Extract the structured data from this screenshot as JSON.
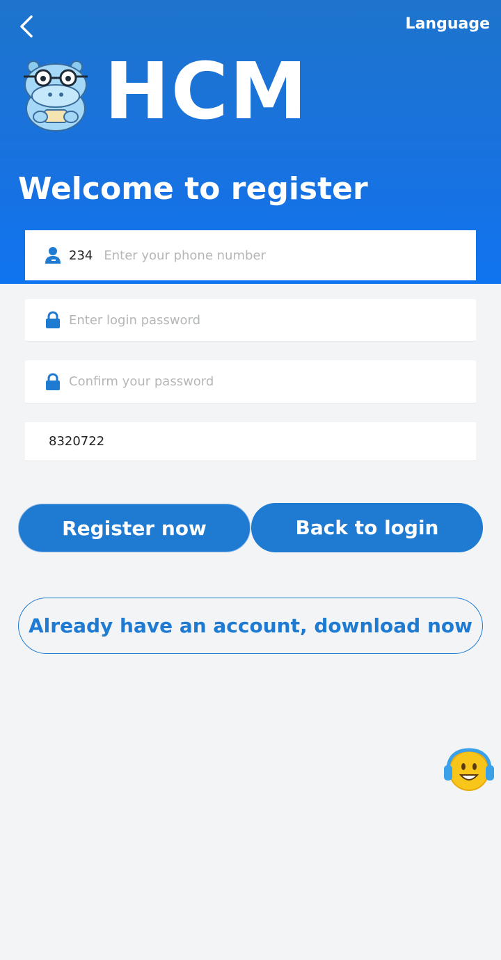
{
  "header": {
    "back_icon": "chevron-left-icon",
    "language_label": "Language",
    "brand": "HCM",
    "welcome": "Welcome to register"
  },
  "form": {
    "phone": {
      "icon": "user-icon",
      "prefix": "234",
      "value": "",
      "placeholder": "Enter your phone number"
    },
    "password": {
      "icon": "lock-icon",
      "value": "",
      "placeholder": "Enter login password"
    },
    "confirm": {
      "icon": "lock-icon",
      "value": "",
      "placeholder": "Confirm your password"
    },
    "invite_code": {
      "value": "8320722",
      "placeholder": ""
    }
  },
  "actions": {
    "register_label": "Register now",
    "back_login_label": "Back to login",
    "download_label": "Already have an account, download now"
  },
  "support": {
    "icon": "customer-service-icon"
  },
  "colors": {
    "primary": "#1f7ad2",
    "hero_top": "#1e74cc",
    "hero_bottom": "#0f74f0",
    "background": "#f2f4f6"
  }
}
